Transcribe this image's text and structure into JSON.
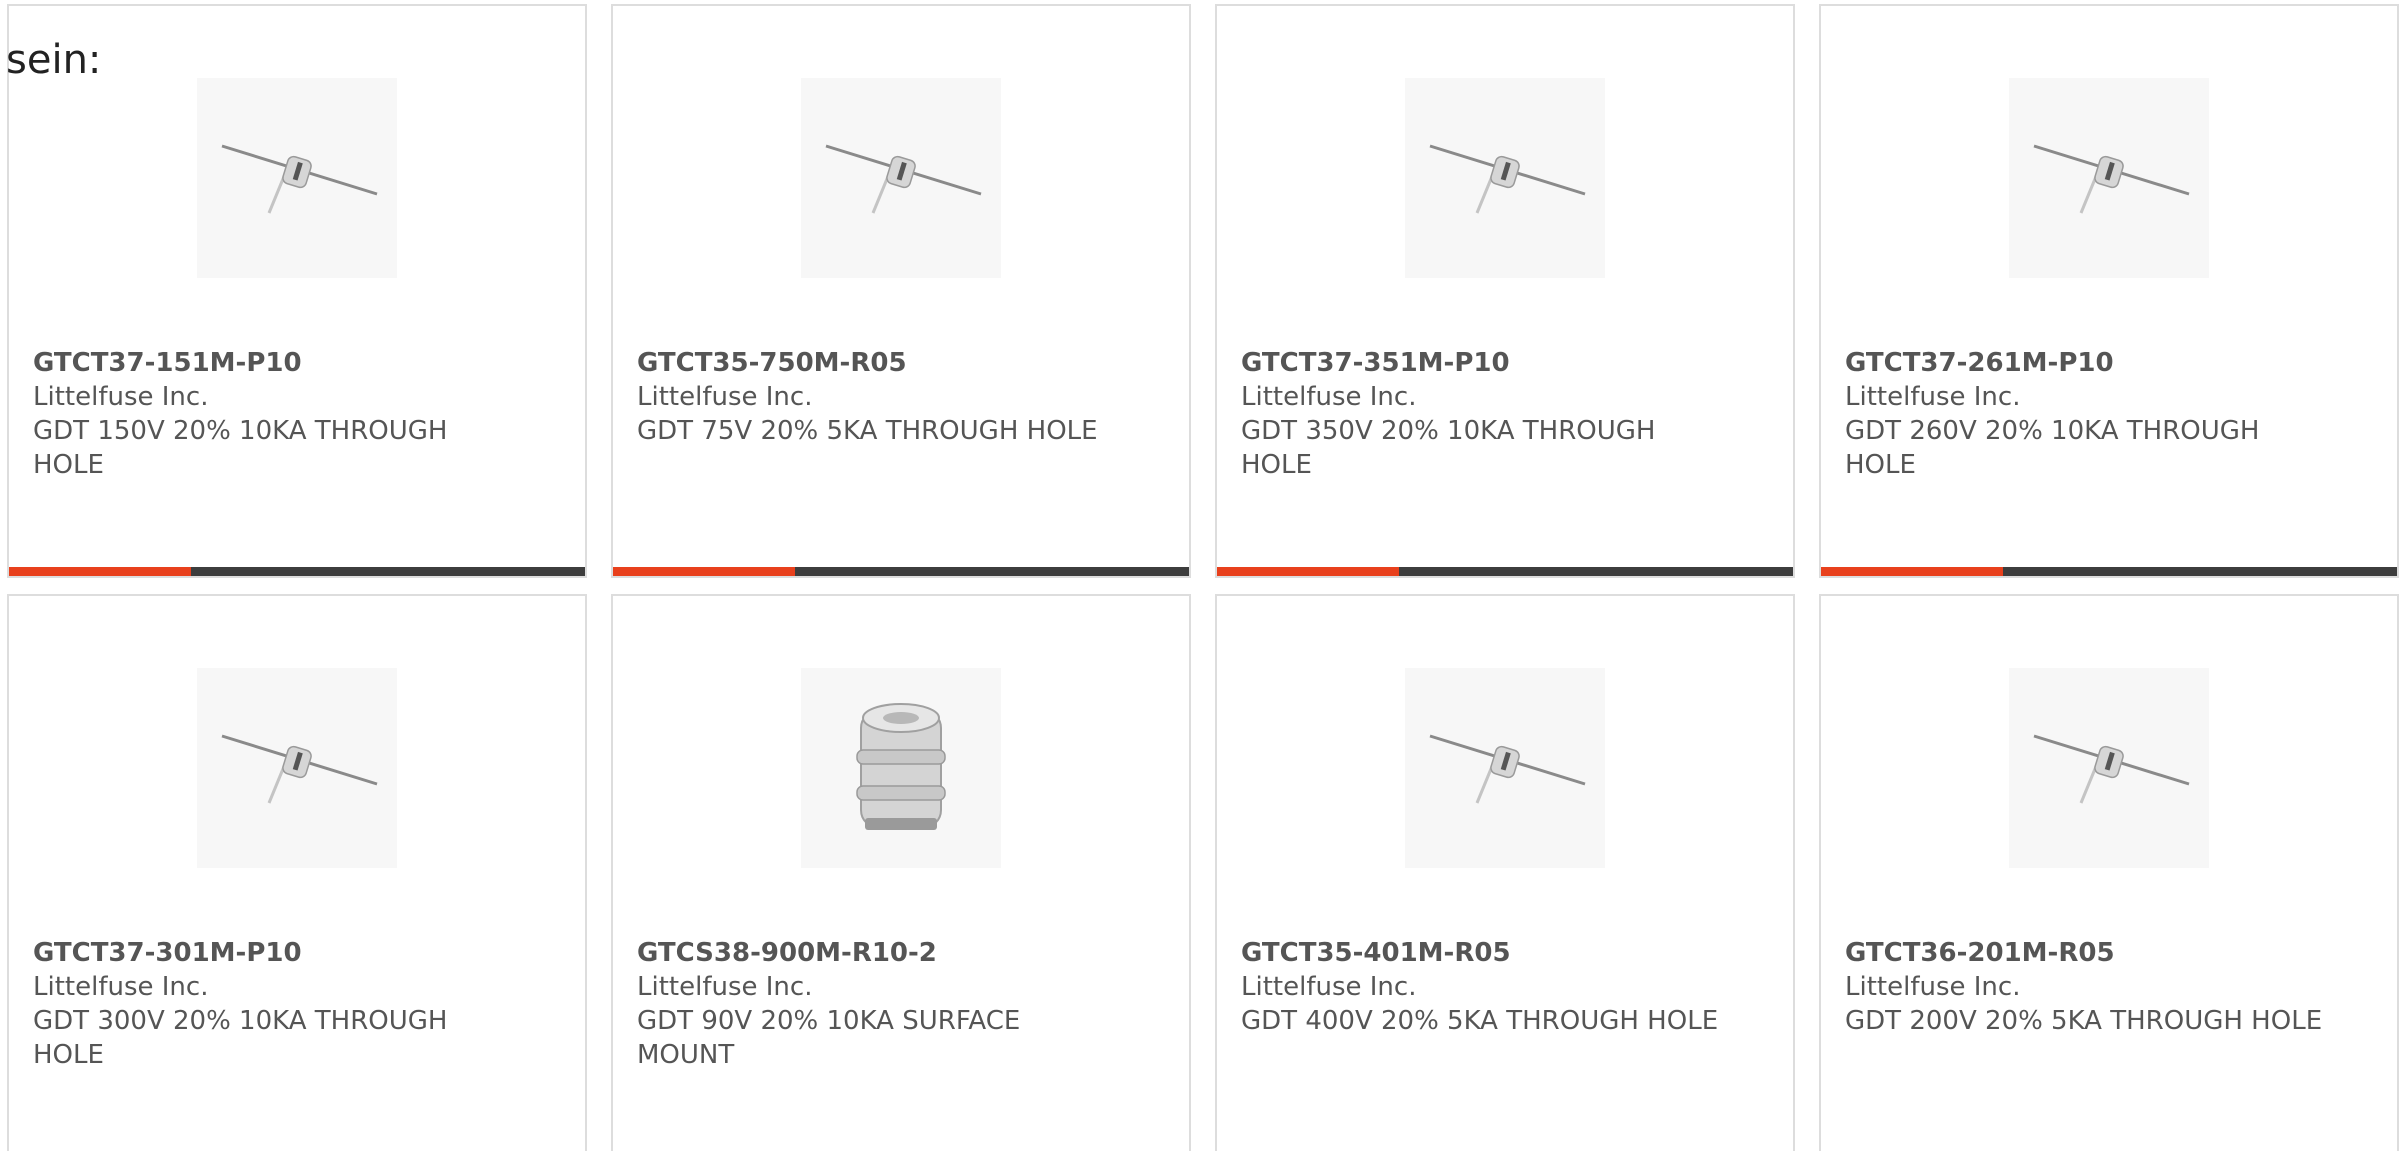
{
  "intro_text": "sein:",
  "colors": {
    "accent": "#e8401c",
    "bar_dark": "#3d3d3d",
    "card_border": "#dddddd",
    "text": "#555555"
  },
  "products": [
    {
      "part_number": "GTCT37-151M-P10",
      "manufacturer": "Littelfuse Inc.",
      "description": "GDT 150V 20% 10KA THROUGH HOLE",
      "image_icon": "gas-discharge-tube-through-hole-icon"
    },
    {
      "part_number": "GTCT35-750M-R05",
      "manufacturer": "Littelfuse Inc.",
      "description": "GDT 75V 20% 5KA THROUGH HOLE",
      "image_icon": "gas-discharge-tube-through-hole-icon"
    },
    {
      "part_number": "GTCT37-351M-P10",
      "manufacturer": "Littelfuse Inc.",
      "description": "GDT 350V 20% 10KA THROUGH HOLE",
      "image_icon": "gas-discharge-tube-through-hole-icon"
    },
    {
      "part_number": "GTCT37-261M-P10",
      "manufacturer": "Littelfuse Inc.",
      "description": "GDT 260V 20% 10KA THROUGH HOLE",
      "image_icon": "gas-discharge-tube-through-hole-icon"
    },
    {
      "part_number": "GTCT37-301M-P10",
      "manufacturer": "Littelfuse Inc.",
      "description": "GDT 300V 20% 10KA THROUGH HOLE",
      "image_icon": "gas-discharge-tube-through-hole-icon"
    },
    {
      "part_number": "GTCS38-900M-R10-2",
      "manufacturer": "Littelfuse Inc.",
      "description": "GDT 90V 20% 10KA SURFACE MOUNT",
      "image_icon": "gas-discharge-tube-surface-mount-icon"
    },
    {
      "part_number": "GTCT35-401M-R05",
      "manufacturer": "Littelfuse Inc.",
      "description": "GDT 400V 20% 5KA THROUGH HOLE",
      "image_icon": "gas-discharge-tube-through-hole-icon"
    },
    {
      "part_number": "GTCT36-201M-R05",
      "manufacturer": "Littelfuse Inc.",
      "description": "GDT 200V 20% 5KA THROUGH HOLE",
      "image_icon": "gas-discharge-tube-through-hole-icon"
    }
  ]
}
